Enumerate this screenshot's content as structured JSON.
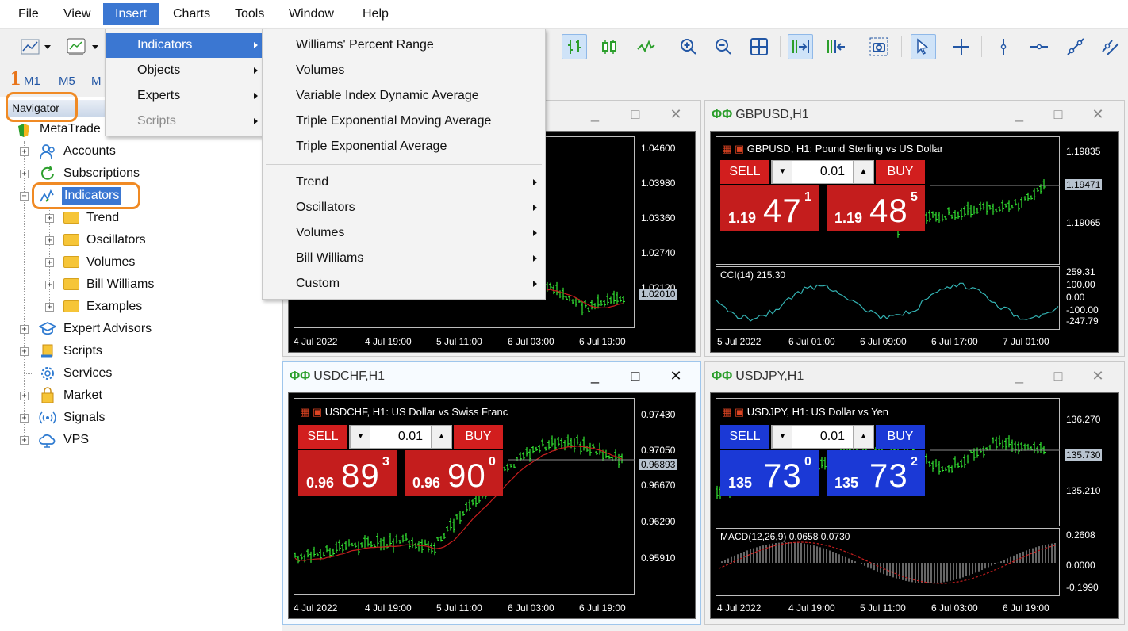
{
  "menu_bar": [
    "File",
    "View",
    "Insert",
    "Charts",
    "Tools",
    "Window",
    "Help"
  ],
  "step_marker": "1",
  "timeframes": [
    "M1",
    "M5",
    "M"
  ],
  "navigator": {
    "title": "Navigator",
    "root": "MetaTrade",
    "items": [
      "Accounts",
      "Subscriptions",
      "Indicators",
      "Expert Advisors",
      "Scripts",
      "Services",
      "Market",
      "Signals",
      "VPS"
    ],
    "indicator_children": [
      "Trend",
      "Oscillators",
      "Volumes",
      "Bill Williams",
      "Examples"
    ]
  },
  "insert_menu": [
    "Indicators",
    "Objects",
    "Experts",
    "Scripts"
  ],
  "indicators_submenu": {
    "top": [
      "Williams' Percent Range",
      "Volumes",
      "Variable Index Dynamic Average",
      "Triple Exponential Moving Average",
      "Triple Exponential Average"
    ],
    "groups": [
      "Trend",
      "Oscillators",
      "Volumes",
      "Bill Williams",
      "Custom"
    ]
  },
  "charts": [
    {
      "id": "hidden",
      "y_ticks": [
        "1.04600",
        "1.03980",
        "1.03360",
        "1.02740",
        "1.02120",
        "1.02010"
      ],
      "x_ticks": [
        "4 Jul 2022",
        "4 Jul 19:00",
        "5 Jul 11:00",
        "6 Jul 03:00",
        "6 Jul 19:00"
      ]
    },
    {
      "id": "gbpusd",
      "title": "GBPUSD,H1",
      "header": "GBPUSD, H1:  Pound Sterling vs US Dollar",
      "sell": "SELL",
      "buy": "BUY",
      "lot": "0.01",
      "bid": {
        "small": "1.19",
        "big": "47",
        "sup": "1"
      },
      "ask": {
        "small": "1.19",
        "big": "48",
        "sup": "5"
      },
      "y_ticks": [
        "1.19835",
        "1.19471",
        "1.19065"
      ],
      "indicator": "CCI(14) 215.30",
      "ind_ticks": [
        "259.31",
        "100.00",
        "0.00",
        "-100.00",
        "-247.79"
      ],
      "x_ticks": [
        "5 Jul 2022",
        "6 Jul 01:00",
        "6 Jul 09:00",
        "6 Jul 17:00",
        "7 Jul 01:00"
      ],
      "panel_color": "#d21e1e"
    },
    {
      "id": "usdchf",
      "title": "USDCHF,H1",
      "header": "USDCHF, H1:  US Dollar vs Swiss Franc",
      "sell": "SELL",
      "buy": "BUY",
      "lot": "0.01",
      "bid": {
        "small": "0.96",
        "big": "89",
        "sup": "3"
      },
      "ask": {
        "small": "0.96",
        "big": "90",
        "sup": "0"
      },
      "y_ticks": [
        "0.97430",
        "0.97050",
        "0.96893",
        "0.96670",
        "0.96290",
        "0.95910"
      ],
      "x_ticks": [
        "4 Jul 2022",
        "4 Jul 19:00",
        "5 Jul 11:00",
        "6 Jul 03:00",
        "6 Jul 19:00"
      ],
      "panel_color": "#d21e1e"
    },
    {
      "id": "usdjpy",
      "title": "USDJPY,H1",
      "header": "USDJPY, H1:  US Dollar vs Yen",
      "sell": "SELL",
      "buy": "BUY",
      "lot": "0.01",
      "bid": {
        "small": "135",
        "big": "73",
        "sup": "0"
      },
      "ask": {
        "small": "135",
        "big": "73",
        "sup": "2"
      },
      "y_ticks": [
        "136.270",
        "135.730",
        "135.210"
      ],
      "indicator": "MACD(12,26,9) 0.0658 0.0730",
      "ind_ticks": [
        "0.2608",
        "0.0000",
        "-0.1990"
      ],
      "x_ticks": [
        "4 Jul 2022",
        "4 Jul 19:00",
        "5 Jul 11:00",
        "6 Jul 03:00",
        "6 Jul 19:00"
      ],
      "panel_color": "#1b39d6"
    }
  ],
  "window_buttons": {
    "min": "_",
    "max": "□",
    "close": "✕"
  },
  "colors": {
    "menu_highlight": "#3b77d2",
    "annotation": "#f08a24",
    "bull": "#33e633",
    "ma": "#c81e1e"
  }
}
